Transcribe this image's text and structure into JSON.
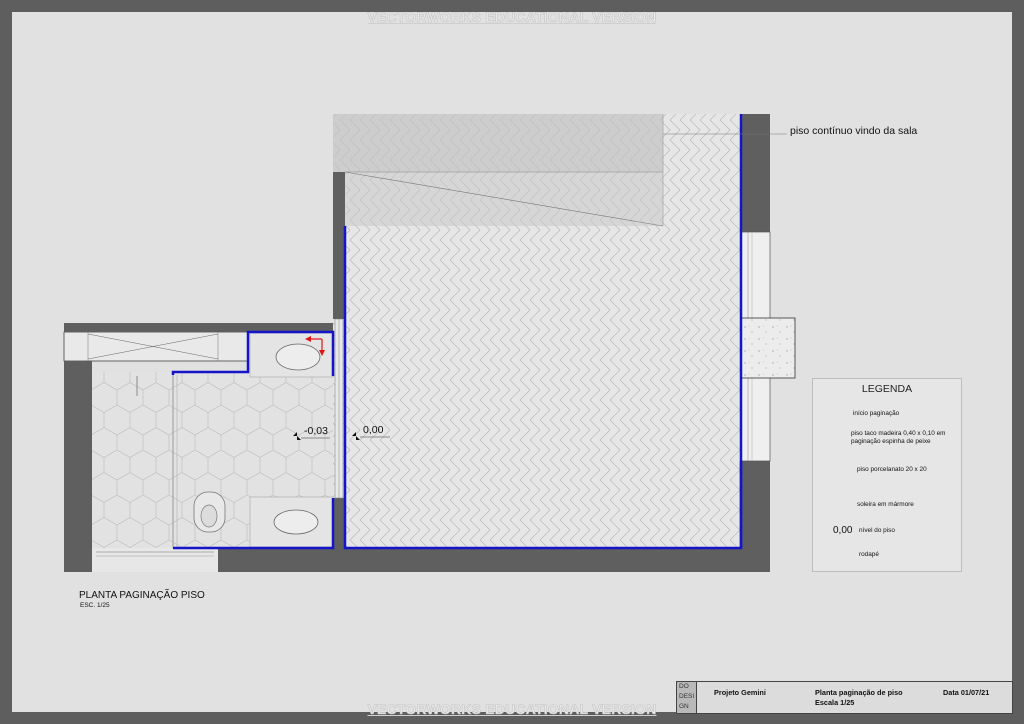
{
  "watermark": "VECTORWORKS EDUCATIONAL VERSION",
  "labels": {
    "continuous_floor": "piso contínuo vindo da sala",
    "level_bath": "-0,03",
    "level_main": "0,00"
  },
  "plan_title": {
    "name": "PLANTA PAGINAÇÃO PISO",
    "scale": "ESC. 1/25"
  },
  "legend": {
    "title": "LEGENDA",
    "items": [
      {
        "symbol": "start-arrow",
        "text": "início paginação"
      },
      {
        "symbol": "wood-swatch",
        "text": "piso taco madeira 0,40 x 0,10 em\npaginação espinha de peixe"
      },
      {
        "symbol": "hexagon",
        "text": "piso porcelanato 20 x 20"
      },
      {
        "symbol": "marble-swatch",
        "text": "soleira em mármore"
      },
      {
        "symbol": "level-marker",
        "value": "0,00",
        "text": "nível do piso"
      },
      {
        "symbol": "blue-line",
        "text": "rodapé"
      }
    ]
  },
  "title_block": {
    "logo": "DO\nDESI\nGN",
    "project": "Projeto Gemini",
    "sheet": "Planta paginação de piso",
    "scale": "Escala 1/25",
    "date": "Data 01/07/21"
  },
  "colors": {
    "wall": "#5f5f5f",
    "baseboard": "#1414c8",
    "start_arrow": "#e01616",
    "marble": "#c9c9c9",
    "floor": "#e6e6e6"
  }
}
